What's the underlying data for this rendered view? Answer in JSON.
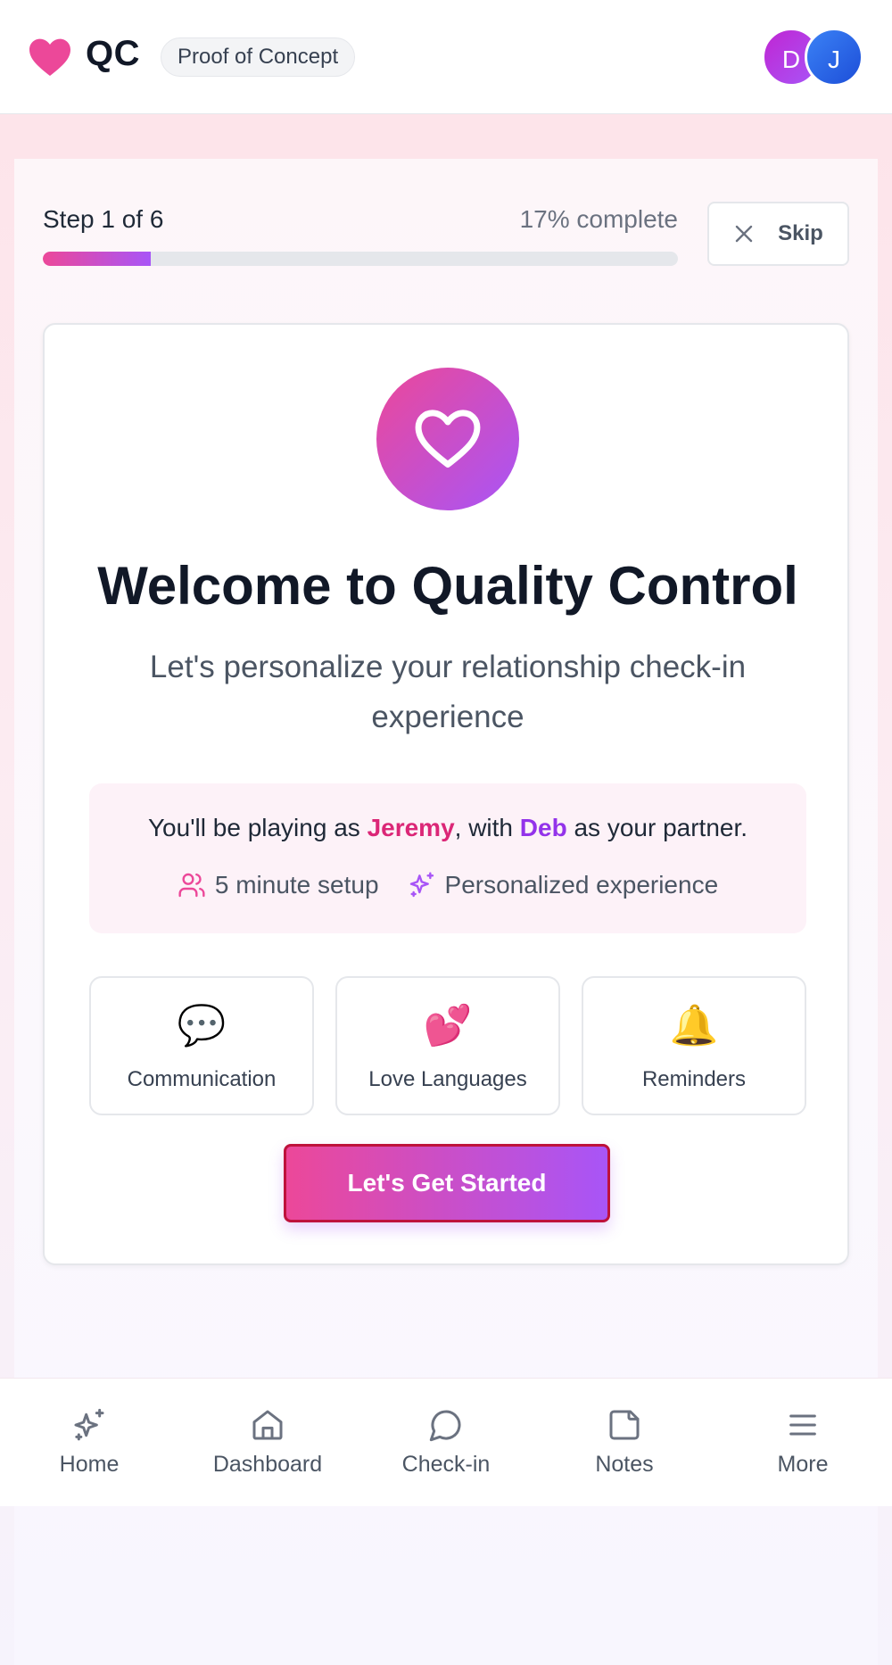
{
  "header": {
    "logo_text": "QC",
    "badge": "Proof of Concept",
    "avatars": [
      {
        "initial": "D"
      },
      {
        "initial": "J"
      }
    ]
  },
  "progress": {
    "step_label": "Step 1 of 6",
    "percent_label": "17% complete",
    "percent": 17,
    "skip_label": "Skip"
  },
  "card": {
    "icon": "heart-icon",
    "title": "Welcome to Quality Control",
    "subtitle": "Let's personalize your relationship check-in experience",
    "info": {
      "prefix": "You'll be playing as ",
      "player_name": "Jeremy",
      "middle": ", with ",
      "partner_name": "Deb",
      "suffix": " as your partner.",
      "meta": [
        {
          "icon": "users-icon",
          "label": "5 minute setup"
        },
        {
          "icon": "sparkles-icon",
          "label": "Personalized experience"
        }
      ]
    },
    "features": [
      {
        "emoji": "💬",
        "label": "Communication"
      },
      {
        "emoji": "💕",
        "label": "Love Languages"
      },
      {
        "emoji": "🔔",
        "label": "Reminders"
      }
    ],
    "cta_label": "Let's Get Started"
  },
  "nav": {
    "items": [
      {
        "icon": "sparkles-icon",
        "label": "Home"
      },
      {
        "icon": "home-icon",
        "label": "Dashboard"
      },
      {
        "icon": "message-circle-icon",
        "label": "Check-in"
      },
      {
        "icon": "note-icon",
        "label": "Notes"
      },
      {
        "icon": "menu-icon",
        "label": "More"
      }
    ]
  },
  "colors": {
    "accent_pink": "#ec4899",
    "accent_purple": "#a855f7"
  }
}
